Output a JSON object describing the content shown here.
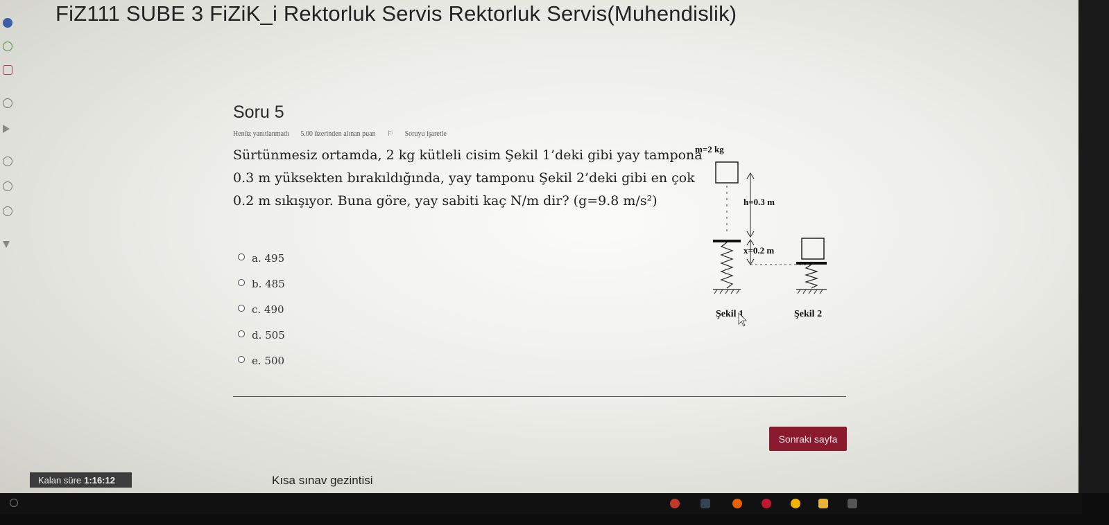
{
  "header": {
    "course_title": "FiZ111 SUBE 3 FiZiK_i Rektorluk Servis Rektorluk Servis(Muhendislik)"
  },
  "question": {
    "title": "Soru 5",
    "status": "Henüz yanıtlanmadı",
    "points": "5.00 üzerinden alınan puan",
    "flag_label": "Soruyu işaretle",
    "text": "Sürtünmesiz ortamda, 2 kg kütleli cisim Şekil 1’deki gibi yay tamponа 0.3 m yüksekten bırakıldığında, yay tamponu Şekil 2’deki gibi en çok 0.2 m sıkışıyor. Buna göre, yay sabiti kaç N/m dir? (g=9.8 m/s²)",
    "answers": [
      {
        "label": "a. 495"
      },
      {
        "label": "b. 485"
      },
      {
        "label": "c. 490"
      },
      {
        "label": "d. 505"
      },
      {
        "label": "e. 500"
      }
    ]
  },
  "figure": {
    "mass_label": "m=2 kg",
    "height_label": "h=0.3 m",
    "compression_label": "x=0.2 m",
    "figure1_label": "Şekil 1",
    "figure2_label": "Şekil 2"
  },
  "navigation": {
    "next_button": "Sonraki sayfa",
    "quiz_nav_label": "Kısa sınav gezintisi"
  },
  "timer": {
    "label": "Kalan süre",
    "value": "1:16:12"
  },
  "colors": {
    "accent": "#8b1a2e",
    "timer_bg": "#3c3c3c"
  }
}
